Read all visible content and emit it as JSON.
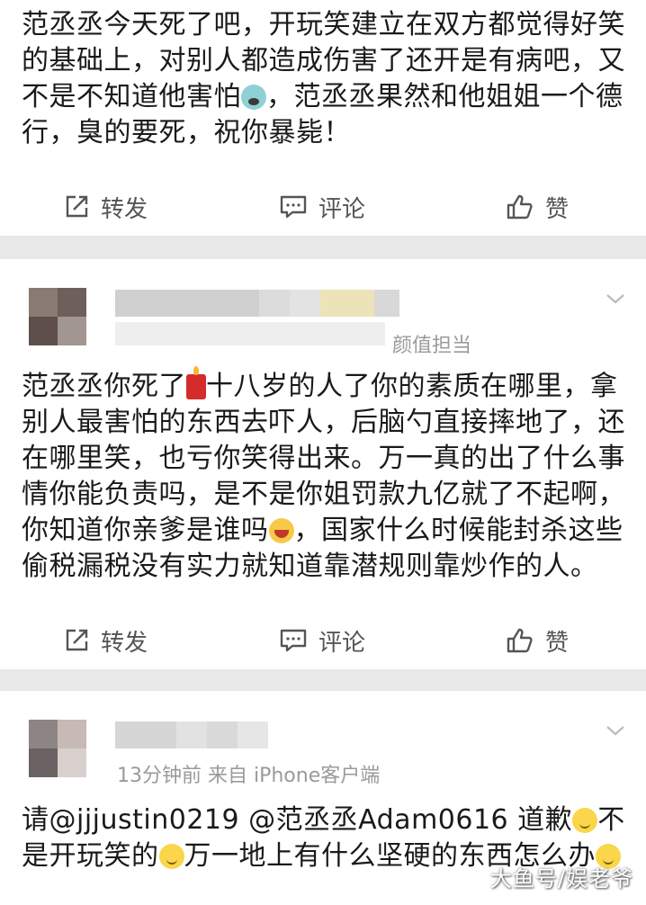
{
  "post1": {
    "text": "范丞丞今天死了吧，开玩笑建立在双方都觉得好笑的基础上，对别人都造成伤害了还开是有病吧，又不是不知道他害怕",
    "text_2": "，范丞丞果然和他姐姐一个德行，臭的要死，祝你暴毙！",
    "emoji_1": "fearful-face-icon"
  },
  "post2": {
    "meta_fragment": "颜值担当",
    "text_1": "范丞丞你死了",
    "text_2": "十八岁的人了你的素质在哪里，拿别人最害怕的东西去吓人，后脑勺直接摔地了，还在哪里笑，也亏你笑得出来。万一真的出了什么事情你能负责吗，是不是你姐罚款九亿就了不起啊，你知道你亲爹是谁吗",
    "text_3": "，国家什么时候能封杀这些偷税漏税没有实力就知道靠潜规则靠炒作的人。",
    "emoji_1": "candle-icon",
    "emoji_2": "laughing-face-icon"
  },
  "post3": {
    "meta": "13分钟前  来自 iPhone客户端",
    "text_1": "请@jjjustin0219 @范丞丞Adam0616 道歉",
    "text_2": "不是开玩笑的",
    "text_3": "万一地上有什么坚硬的东西怎么办",
    "emoji": "smiling-face-icon"
  },
  "actions": {
    "repost": "转发",
    "comment": "评论",
    "like": "赞"
  },
  "watermark": "大鱼号/娱老爷",
  "colors": {
    "background": "#ececec",
    "card": "#ffffff",
    "text": "#1a1a1a",
    "muted": "#9a9a9a"
  }
}
